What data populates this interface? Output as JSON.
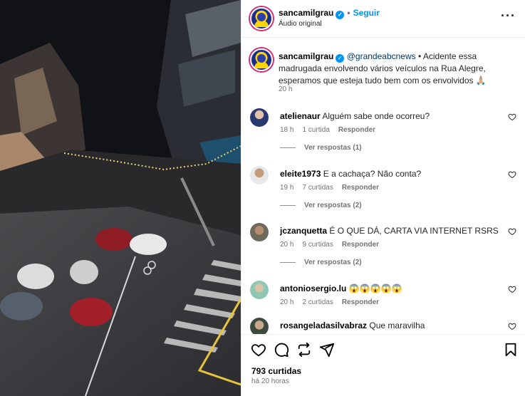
{
  "header": {
    "username": "sancamilgrau",
    "follow_label": "Seguir",
    "audio": "Áudio original"
  },
  "caption": {
    "username": "sancamilgrau",
    "mention": "@grandeabcnews",
    "text": " • Acidente essa madrugada envolvendo vários veículos na Rua Alegre, esperamos que esteja tudo bem com os envolvidos 🙏🏼",
    "time": "20 h"
  },
  "comments": [
    {
      "username": "atelienaur",
      "text": "Alguém sabe onde ocorreu?",
      "time": "18 h",
      "likes": "1 curtida",
      "reply": "Responder",
      "replies": "Ver respostas (1)"
    },
    {
      "username": "eleite1973",
      "text": "E a cachaça? Não conta?",
      "time": "19 h",
      "likes": "7 curtidas",
      "reply": "Responder",
      "replies": "Ver respostas (2)"
    },
    {
      "username": "jczanquetta",
      "text": "É O QUE DÁ, CARTA VIA INTERNET RSRS",
      "time": "20 h",
      "likes": "9 curtidas",
      "reply": "Responder",
      "replies": "Ver respostas (2)"
    },
    {
      "username": "antoniosergio.lu",
      "text": "😱😱😱😱😱",
      "time": "20 h",
      "likes": "2 curtidas",
      "reply": "Responder",
      "replies": ""
    },
    {
      "username": "rosangeladasilvabraz",
      "text": "Que maravilha",
      "time": "",
      "likes": "",
      "reply": "",
      "replies": ""
    }
  ],
  "footer": {
    "likes": "793 curtidas",
    "ago": "há 20 horas"
  },
  "icons": {
    "like": "heart-icon",
    "comment": "comment-icon",
    "share": "repost-icon",
    "send": "send-icon",
    "save": "bookmark-icon"
  },
  "colors": {
    "accent": "#0095f6",
    "muted": "#737373"
  }
}
